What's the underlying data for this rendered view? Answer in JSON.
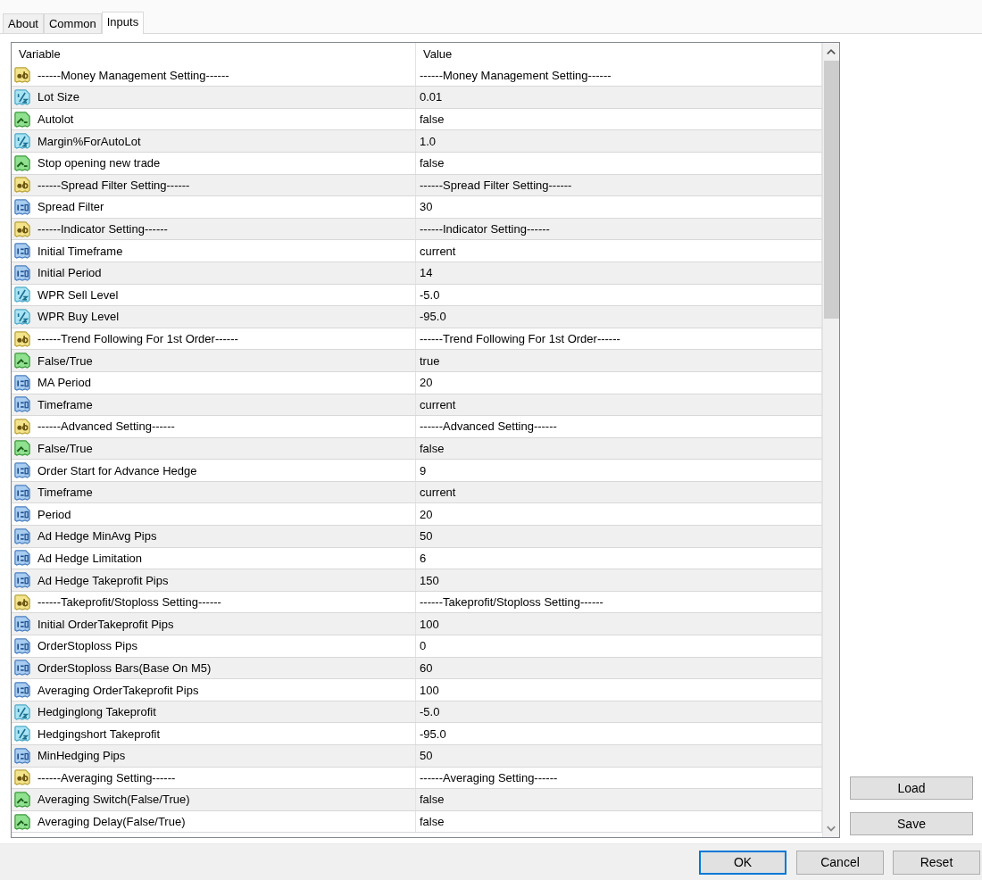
{
  "tabs": [
    {
      "label": "About",
      "selected": false
    },
    {
      "label": "Common",
      "selected": false
    },
    {
      "label": "Inputs",
      "selected": true
    }
  ],
  "columns": [
    "Variable",
    "Value"
  ],
  "rows": [
    {
      "kind": "string",
      "variable": "------Money Management Setting------",
      "value": "------Money Management Setting------"
    },
    {
      "kind": "double",
      "variable": "Lot Size",
      "value": "0.01"
    },
    {
      "kind": "bool",
      "variable": "Autolot",
      "value": "false"
    },
    {
      "kind": "double",
      "variable": "Margin%ForAutoLot",
      "value": "1.0"
    },
    {
      "kind": "bool",
      "variable": "Stop opening new trade",
      "value": "false"
    },
    {
      "kind": "string",
      "variable": "------Spread Filter Setting------",
      "value": "------Spread Filter Setting------"
    },
    {
      "kind": "int",
      "variable": "Spread Filter",
      "value": "30"
    },
    {
      "kind": "string",
      "variable": "------Indicator Setting------",
      "value": "------Indicator Setting------"
    },
    {
      "kind": "int",
      "variable": "Initial Timeframe",
      "value": "current"
    },
    {
      "kind": "int",
      "variable": "Initial Period",
      "value": "14"
    },
    {
      "kind": "double",
      "variable": "WPR Sell Level",
      "value": "-5.0"
    },
    {
      "kind": "double",
      "variable": "WPR Buy Level",
      "value": "-95.0"
    },
    {
      "kind": "string",
      "variable": "------Trend Following For 1st Order------",
      "value": "------Trend Following For 1st Order------"
    },
    {
      "kind": "bool",
      "variable": "False/True",
      "value": "true"
    },
    {
      "kind": "int",
      "variable": "MA Period",
      "value": "20"
    },
    {
      "kind": "int",
      "variable": "Timeframe",
      "value": "current"
    },
    {
      "kind": "string",
      "variable": "------Advanced Setting------",
      "value": "------Advanced Setting------"
    },
    {
      "kind": "bool",
      "variable": "False/True",
      "value": "false"
    },
    {
      "kind": "int",
      "variable": "Order Start for Advance Hedge",
      "value": "9"
    },
    {
      "kind": "int",
      "variable": "Timeframe",
      "value": "current"
    },
    {
      "kind": "int",
      "variable": "Period",
      "value": "20"
    },
    {
      "kind": "int",
      "variable": "Ad Hedge MinAvg Pips",
      "value": "50"
    },
    {
      "kind": "int",
      "variable": "Ad Hedge Limitation",
      "value": "6"
    },
    {
      "kind": "int",
      "variable": "Ad Hedge Takeprofit Pips",
      "value": "150"
    },
    {
      "kind": "string",
      "variable": "------Takeprofit/Stoploss Setting------",
      "value": "------Takeprofit/Stoploss Setting------"
    },
    {
      "kind": "int",
      "variable": "Initial OrderTakeprofit Pips",
      "value": "100"
    },
    {
      "kind": "int",
      "variable": "OrderStoploss Pips",
      "value": "0"
    },
    {
      "kind": "int",
      "variable": "OrderStoploss Bars(Base On M5)",
      "value": "60"
    },
    {
      "kind": "int",
      "variable": "Averaging OrderTakeprofit Pips",
      "value": "100"
    },
    {
      "kind": "double",
      "variable": "Hedginglong Takeprofit",
      "value": "-5.0"
    },
    {
      "kind": "double",
      "variable": "Hedgingshort Takeprofit",
      "value": "-95.0"
    },
    {
      "kind": "int",
      "variable": "MinHedging Pips",
      "value": "50"
    },
    {
      "kind": "string",
      "variable": "------Averaging Setting------",
      "value": "------Averaging Setting------"
    },
    {
      "kind": "bool",
      "variable": "Averaging Switch(False/True)",
      "value": "false"
    },
    {
      "kind": "bool",
      "variable": "Averaging Delay(False/True)",
      "value": "false"
    }
  ],
  "side_buttons": [
    "Load",
    "Save"
  ],
  "dialog_buttons": [
    {
      "label": "OK",
      "default": true
    },
    {
      "label": "Cancel",
      "default": false
    },
    {
      "label": "Reset",
      "default": false
    }
  ]
}
